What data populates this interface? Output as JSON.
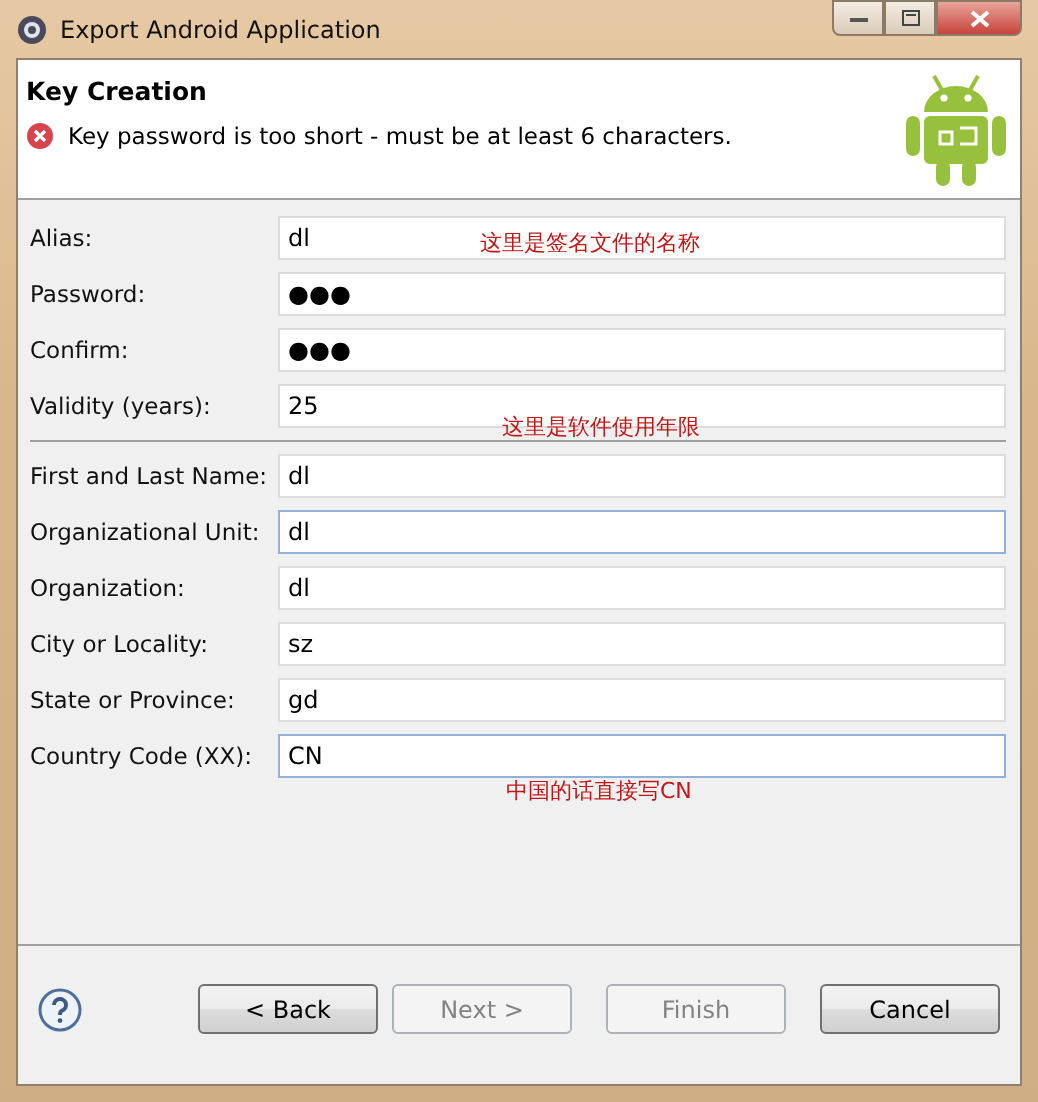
{
  "window": {
    "title": "Export Android Application"
  },
  "header": {
    "title": "Key Creation",
    "error": "Key password is too short - must be at least 6 characters."
  },
  "groups": [
    {
      "fields": [
        {
          "label": "Alias:",
          "value": "dl",
          "focused": false,
          "note": "这里是签名文件的名称"
        },
        {
          "label": "Password:",
          "value": "●●●",
          "focused": false
        },
        {
          "label": "Confirm:",
          "value": "●●●",
          "focused": false
        },
        {
          "label": "Validity (years):",
          "value": "25",
          "focused": false,
          "note": "这里是软件使用年限"
        }
      ]
    },
    {
      "fields": [
        {
          "label": "First and Last Name:",
          "value": "dl",
          "focused": false
        },
        {
          "label": "Organizational Unit:",
          "value": "dl",
          "focused": true
        },
        {
          "label": "Organization:",
          "value": "dl",
          "focused": false
        },
        {
          "label": "City or Locality:",
          "value": "sz",
          "focused": false
        },
        {
          "label": "State or Province:",
          "value": "gd",
          "focused": false
        },
        {
          "label": "Country Code (XX):",
          "value": "CN",
          "focused": true,
          "note": "中国的话直接写CN"
        }
      ]
    }
  ],
  "buttons": [
    {
      "label": "< Back",
      "disabled": false
    },
    {
      "label": "Next >",
      "disabled": true
    },
    {
      "label": "Finish",
      "disabled": true
    },
    {
      "label": "Cancel",
      "disabled": false
    }
  ]
}
